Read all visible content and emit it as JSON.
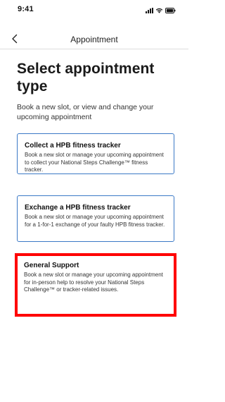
{
  "status_bar": {
    "time": "9:41",
    "icons": [
      "signal-icon",
      "wifi-icon",
      "battery-icon"
    ]
  },
  "nav": {
    "back_icon": "chevron-left-icon",
    "title": "Appointment"
  },
  "page": {
    "title": "Select appointment type",
    "subtitle": "Book a new slot, or view and change your upcoming appointment"
  },
  "options": [
    {
      "title": "Collect a HPB fitness tracker",
      "description": "Book a new slot or manage your upcoming appointment to collect your National Steps Challenge™ fitness tracker."
    },
    {
      "title": "Exchange a HPB fitness tracker",
      "description": "Book a new slot or manage your upcoming appointment for a 1-for-1 exchange of your faulty HPB fitness tracker."
    },
    {
      "title": "General Support",
      "description": "Book a new slot or manage your upcoming appointment for in-person help to resolve your National Steps Challenge™ or tracker-related issues.",
      "highlighted": true
    }
  ],
  "colors": {
    "card_border": "#3b79c6",
    "highlight": "#ff0000",
    "text": "#222222"
  }
}
